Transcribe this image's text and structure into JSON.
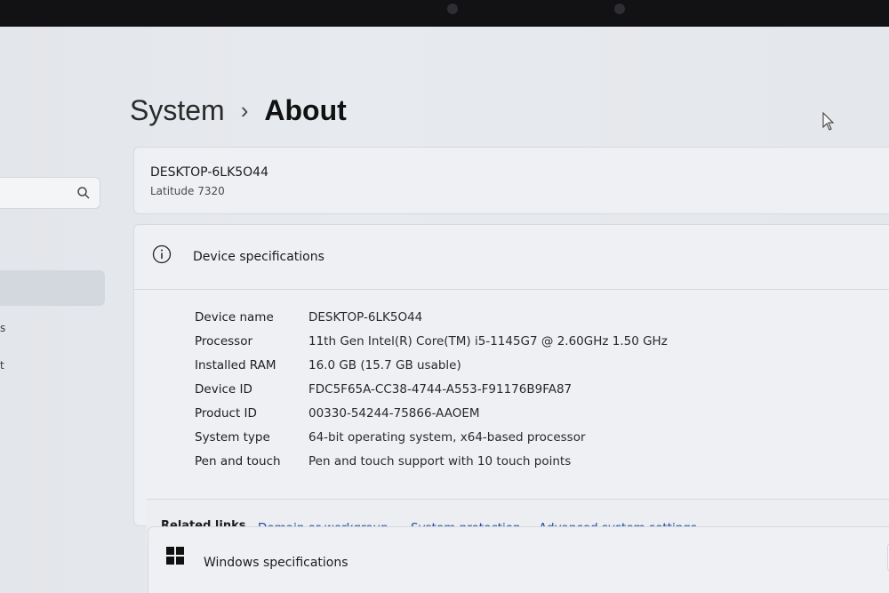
{
  "breadcrumb": {
    "parent": "System",
    "separator": "›",
    "current": "About"
  },
  "device": {
    "name": "DESKTOP-6LK5O44",
    "model": "Latitude 7320"
  },
  "specs": {
    "title": "Device specifications",
    "rows": [
      {
        "label": "Device name",
        "value": "DESKTOP-6LK5O44"
      },
      {
        "label": "Processor",
        "value": "11th Gen Intel(R) Core(TM) i5-1145G7 @ 2.60GHz   1.50 GHz"
      },
      {
        "label": "Installed RAM",
        "value": "16.0 GB (15.7 GB usable)"
      },
      {
        "label": "Device ID",
        "value": "FDC5F65A-CC38-4744-A553-F91176B9FA87"
      },
      {
        "label": "Product ID",
        "value": "00330-54244-75866-AAOEM"
      },
      {
        "label": "System type",
        "value": "64-bit operating system, x64-based processor"
      },
      {
        "label": "Pen and touch",
        "value": "Pen and touch support with 10 touch points"
      }
    ]
  },
  "related": {
    "title": "Related links",
    "links": [
      "Domain or workgroup",
      "System protection",
      "Advanced system settings"
    ]
  },
  "windows_specs": {
    "title": "Windows specifications"
  },
  "sidebar": {
    "fragments": [
      "s",
      "t"
    ]
  },
  "colors": {
    "link": "#1f4fa0",
    "background": "#e5e8ec",
    "card": "#eef0f3"
  }
}
